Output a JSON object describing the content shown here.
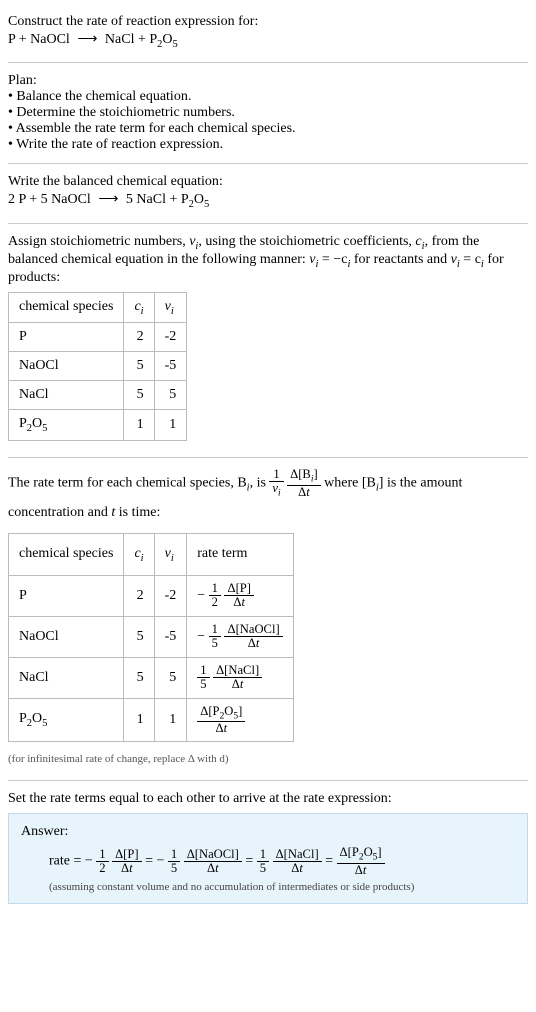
{
  "header": {
    "construct_line": "Construct the rate of reaction expression for:"
  },
  "plan": {
    "title": "Plan:",
    "items": [
      "Balance the chemical equation.",
      "Determine the stoichiometric numbers.",
      "Assemble the rate term for each chemical species.",
      "Write the rate of reaction expression."
    ]
  },
  "balanced_intro": "Write the balanced chemical equation:",
  "stoich_intro_a": "Assign stoichiometric numbers, ",
  "stoich_intro_b": ", using the stoichiometric coefficients, ",
  "stoich_intro_c": ", from the balanced chemical equation in the following manner: ",
  "stoich_intro_d": " for reactants and ",
  "stoich_intro_e": " for products:",
  "table1": {
    "headers": {
      "species": "chemical species"
    },
    "rows": [
      {
        "sp": "P",
        "c": "2",
        "v": "-2"
      },
      {
        "sp": "NaOCl",
        "c": "5",
        "v": "-5"
      },
      {
        "sp": "NaCl",
        "c": "5",
        "v": "5"
      },
      {
        "sp": "P2O5",
        "c": "1",
        "v": "1"
      }
    ]
  },
  "rate_term_a": "The rate term for each chemical species, B",
  "rate_term_b": ", is ",
  "rate_term_c": " where [B",
  "rate_term_d": "] is the amount concentration and ",
  "rate_term_e": " is time:",
  "table2": {
    "headers": {
      "species": "chemical species",
      "rate": "rate term"
    },
    "rows": [
      {
        "sp": "P",
        "c": "2",
        "v": "-2"
      },
      {
        "sp": "NaOCl",
        "c": "5",
        "v": "-5"
      },
      {
        "sp": "NaCl",
        "c": "5",
        "v": "5"
      },
      {
        "sp": "P2O5",
        "c": "1",
        "v": "1"
      }
    ]
  },
  "infinitesimal_note": "(for infinitesimal rate of change, replace Δ with d)",
  "set_equal": "Set the rate terms equal to each other to arrive at the rate expression:",
  "answer": {
    "label": "Answer:",
    "prefix": "rate = ",
    "note": "(assuming constant volume and no accumulation of intermediates or side products)"
  },
  "tokens": {
    "delta": "Δ",
    "P": "P",
    "NaOCl": "NaOCl",
    "NaCl": "NaCl",
    "one": "1",
    "two": "2",
    "five": "5",
    "t": "t",
    "i": "i",
    "nu": "ν",
    "c": "c",
    "minus": "−",
    "eq": " = ",
    "neg_ci": " = −c",
    "eq_ci": " = c"
  }
}
